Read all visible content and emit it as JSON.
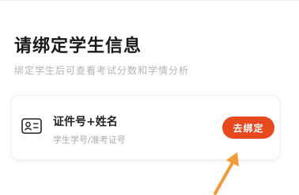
{
  "page": {
    "title": "请绑定学生信息",
    "subtitle": "绑定学生后可查看考试分数和学情分析"
  },
  "bind_card": {
    "icon": "id-card-icon",
    "title": "证件号+姓名",
    "hint": "学生学号/准考证号",
    "button_label": "去绑定"
  },
  "colors": {
    "accent": "#e8481d",
    "arrow": "#f39a3a",
    "title_text": "#1a1a1a",
    "muted_text": "#b3b3b3"
  }
}
